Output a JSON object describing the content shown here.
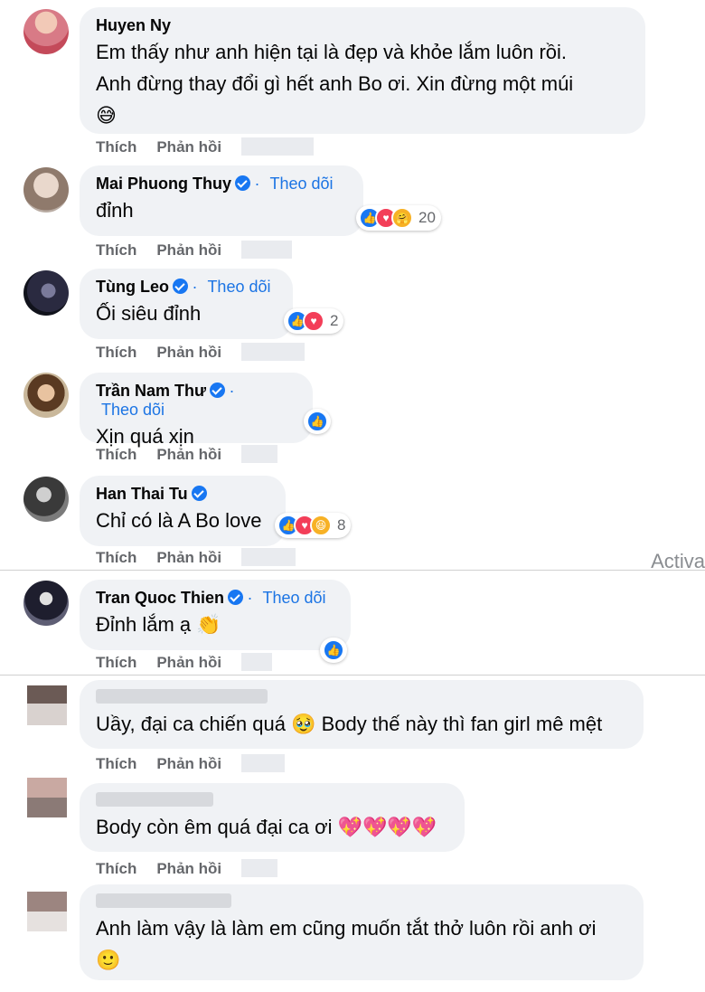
{
  "actions": {
    "like": "Thích",
    "reply": "Phản hồi"
  },
  "follow_label": "Theo dõi",
  "watermark": "Activa",
  "comments": [
    {
      "name": "Huyen Ny",
      "text1": "Em thấy như anh hiện tại là đẹp và khỏe lắm luôn rồi.",
      "text2": "Anh đừng thay đổi gì hết anh Bo ơi. Xin đừng một múi",
      "emoji": "😅"
    },
    {
      "name": "Mai Phuong Thuy",
      "text": "đỉnh",
      "reaction_count": "20"
    },
    {
      "name": "Tùng Leo",
      "text": "Ối siêu đỉnh",
      "reaction_count": "2"
    },
    {
      "name": "Trần Nam Thư",
      "text": "Xịn quá xịn"
    },
    {
      "name": "Han Thai Tu",
      "text": "Chỉ có là A Bo love",
      "reaction_count": "8"
    },
    {
      "name": "Tran Quoc Thien",
      "text": "Đỉnh lắm ạ",
      "emoji": "👏"
    },
    {
      "text": "Uầy, đại ca chiến quá",
      "emoji": "🥹",
      "text2": "Body thế này thì fan girl mê mệt"
    },
    {
      "text": "Body còn êm quá đại ca ơi",
      "emoji": "💖💖💖💖"
    },
    {
      "text": "Anh làm vậy là làm em cũng muốn tắt thở luôn rồi anh ơi",
      "emoji": "🙂"
    }
  ],
  "colors": {
    "bubble": "#f0f2f5",
    "link": "#1b74e4",
    "like": "#1877f2",
    "love": "#f33e58",
    "muted": "#65676b"
  }
}
